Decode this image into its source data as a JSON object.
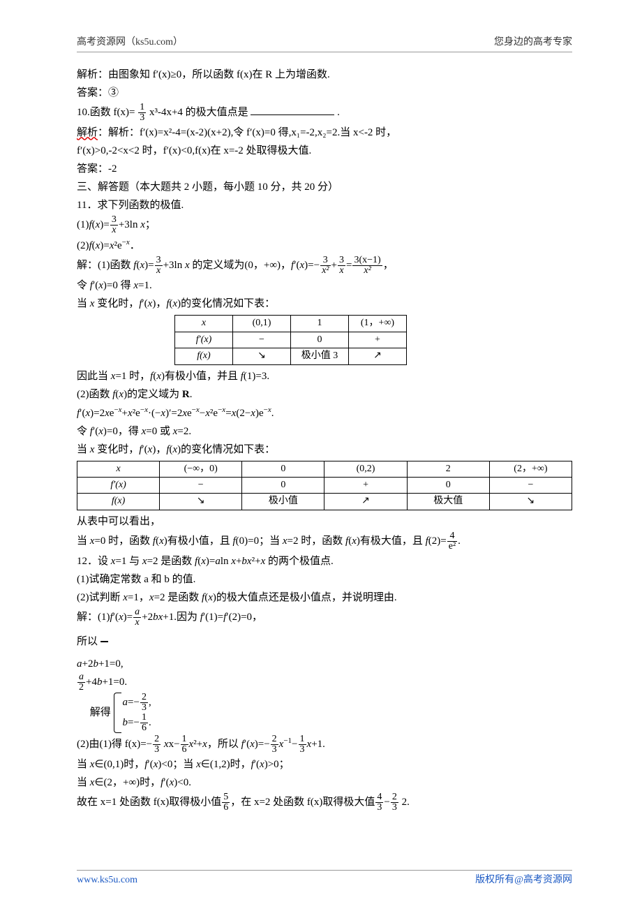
{
  "header": {
    "left": "高考资源网（ks5u.com）",
    "right": "您身边的高考专家"
  },
  "footer": {
    "url": "www.ks5u.com",
    "copyright": "版权所有@高考资源网"
  },
  "p": {
    "q9_analysis": "解析：由图象知 f′(x)≥0，所以函数 f(x)在 R 上为增函数.",
    "q9_answer_label": "答案：③",
    "q10_stem_pre": " 10.函数 f(x)=",
    "q10_stem_post": "x³-4x+4 的极大值点是",
    "q10_blank_end": ".",
    "q10_analysis_1_a": "解析",
    "q10_analysis_1_b": "：解析：f′(x)=x²-4=(x-2)(x+2),令 f′(x)=0 得,x₁=-2,x₂=2.当 x<-2 时，",
    "q10_analysis_2": "f′(x)>0,-2<x<2 时，f′(x)<0,f(x)在 x=-2 处取得极大值.",
    "q10_answer": "答案：-2",
    "s3_title": "三、解答题（本大题共 2 小题，每小题 10 分，共 20 分）",
    "q11_title": "11．求下列函数的极值.",
    "q11_1": "(1)f(x)=(3/x)+3ln x；",
    "q11_2": "(2)f(x)=x²e⁻ˣ．",
    "q11_sol_label": "解：",
    "q11_sol_1a": "(1)函数 f(x)=(3/x)+3ln x 的定义域为(0，+∞)，f′(x)=−(3/x²)+(3/x)=(3(x−1))/x²，",
    "q11_sol_1b": "令 f′(x)=0 得 x=1.",
    "q11_sol_1c": "当 x 变化时，f′(x)，f(x)的变化情况如下表：",
    "q11_sol_1d": "因此当 x=1 时，f(x)有极小值，并且 f(1)=3.",
    "q11_sol_2a": "(2)函数 f(x)的定义域为 R.",
    "q11_sol_2b": "f′(x)=2xe⁻ˣ+x²e⁻ˣ·(−x)′=2xe⁻ˣ−x²e⁻ˣ=x(2−x)e⁻ˣ.",
    "q11_sol_2c": "令 f′(x)=0，得 x=0 或 x=2.",
    "q11_sol_2d": "当 x 变化时，f′(x)，f(x)的变化情况如下表：",
    "q11_sol_2e": "从表中可以看出，",
    "q11_sol_2f": "当 x=0 时，函数 f(x)有极小值，且 f(0)=0；当 x=2 时，函数 f(x)有极大值，且 f(2)=4/e².",
    "q12_title": "12．设 x=1 与 x=2 是函数 f(x)=aln x+bx²+x 的两个极值点.",
    "q12_1": "(1)试确定常数 a 和 b 的值.",
    "q12_2": "(2)试判断 x=1，x=2 是函数 f(x)的极大值点还是极小值点，并说明理由.",
    "q12_sol_label": "解：",
    "q12_sol_1a": "(1)f′(x)=(a/x)+2bx+1.因为 f′(1)=f′(2)=0，",
    "q12_sol_so": "所以",
    "q12_sol_solve": "解得",
    "q12_sys_1": "a+2b+1=0,",
    "q12_sys_2a": "(a/2)+4b+1=0.",
    "q12_res_1": "a=−2/3,",
    "q12_res_2": "b=−1/6.",
    "q12_sol_2a_pre": "(2)由(1)得 f(x)=−",
    "q12_sol_2a_mid1": "x−",
    "q12_sol_2a_mid2": "x²+x，所以 f′(x)=−",
    "q12_sol_2a_mid3": "x⁻¹−",
    "q12_sol_2a_end": "x+1.",
    "q12_sol_2b": "当 x∈(0,1)时，f′(x)<0；当 x∈(1,2)时，f′(x)>0；",
    "q12_sol_2c": "当 x∈(2，+∞)时，f′(x)<0.",
    "q12_sol_2d_pre": "故在 x=1 处函数 f(x)取得极小值",
    "q12_sol_2d_mid": "，在 x=2 处函数 f(x)取得极大值",
    "q12_sol_2d_dash": "−",
    "q12_sol_2d_end": " 2."
  },
  "frac": {
    "one_third_n": "1",
    "one_third_d": "3",
    "three_x_n": "3",
    "x_d": "x",
    "three_x2_n": "3",
    "x2_d": "x²",
    "three_xm1_n": "3(x−1)",
    "four_e2_n": "4",
    "e2_d": "e²",
    "a_x_n": "a",
    "a_2_n": "a",
    "two_d": "2",
    "two_three_n": "2",
    "three_d": "3",
    "one_six_n": "1",
    "six_d": "6",
    "one_three_n": "1",
    "five_six_n": "5",
    "four_three_n": "4"
  },
  "table1": {
    "r0": [
      "x",
      "(0,1)",
      "1",
      "(1，+∞)"
    ],
    "r1": [
      "f′(x)",
      "−",
      "0",
      "+"
    ],
    "r2": [
      "f(x)",
      "↘",
      "极小值 3",
      "↗"
    ]
  },
  "table2": {
    "r0": [
      "x",
      "(−∞，0)",
      "0",
      "(0,2)",
      "2",
      "(2，+∞)"
    ],
    "r1": [
      "f′(x)",
      "−",
      "0",
      "+",
      "0",
      "−"
    ],
    "r2": [
      "f(x)",
      "↘",
      "极小值",
      "↗",
      "极大值",
      "↘"
    ]
  },
  "ln_wavy": "ln"
}
